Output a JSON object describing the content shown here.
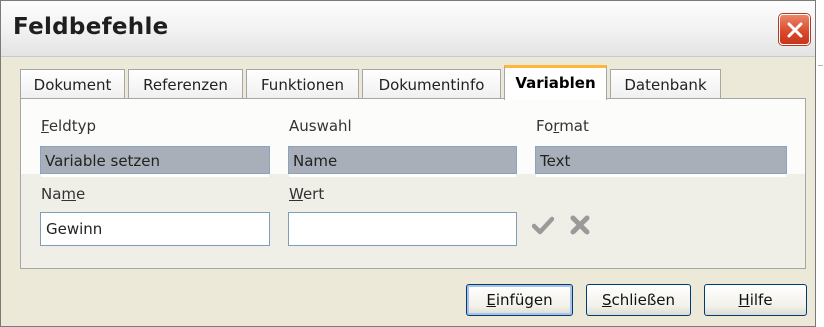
{
  "dialog": {
    "title": "Feldbefehle"
  },
  "tabs": [
    {
      "label": "Dokument"
    },
    {
      "label": "Referenzen"
    },
    {
      "label": "Funktionen"
    },
    {
      "label": "Dokumentinfo"
    },
    {
      "label": "Variablen",
      "active": true
    },
    {
      "label": "Datenbank"
    }
  ],
  "fields": {
    "feldtyp": {
      "label_mnemonic": "F",
      "label_rest": "eldtyp",
      "selected": "Variable setzen"
    },
    "auswahl": {
      "label_pre": "Auswahl",
      "selected": "Name"
    },
    "format": {
      "label_pre": "Fo",
      "label_mnemonic": "r",
      "label_rest": "mat",
      "selected": "Text"
    },
    "name": {
      "label_pre": "Na",
      "label_mnemonic": "m",
      "label_rest": "e",
      "value": "Gewinn"
    },
    "wert": {
      "label_mnemonic": "W",
      "label_rest": "ert",
      "value": ""
    }
  },
  "icons": {
    "apply": "checkmark-icon",
    "delete": "delete-x-icon",
    "close": "close-icon"
  },
  "buttons": {
    "insert": {
      "mnemonic": "E",
      "rest": "infügen"
    },
    "close": {
      "mnemonic": "S",
      "rest": "chließen"
    },
    "help": {
      "mnemonic": "H",
      "rest": "ilfe"
    }
  },
  "colors": {
    "active_tab_accent": "#ffb63a",
    "close_button": "#d9482a",
    "selection": "#a8afb9"
  }
}
